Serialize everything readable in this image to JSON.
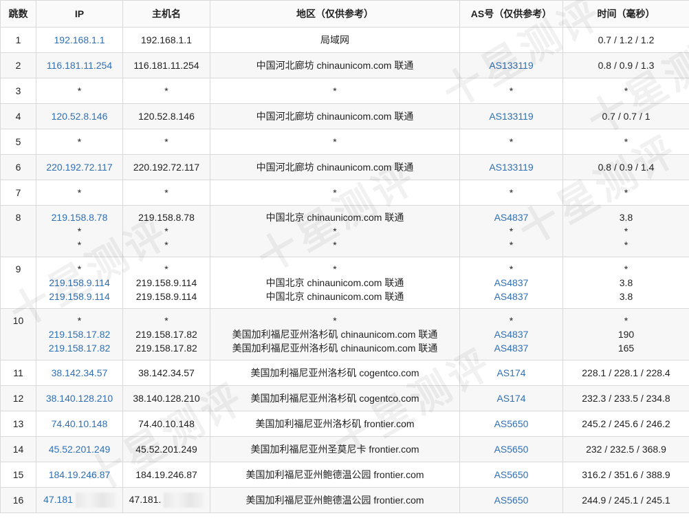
{
  "headers": [
    "跳数",
    "IP",
    "主机名",
    "地区（仅供参考）",
    "AS号（仅供参考）",
    "时间（毫秒）"
  ],
  "rows": [
    {
      "hop": "1",
      "lines": [
        {
          "ip": "192.168.1.1",
          "host": "192.168.1.1",
          "region": "局域网",
          "as": "",
          "time": "0.7 / 1.2 / 1.2"
        }
      ]
    },
    {
      "hop": "2",
      "lines": [
        {
          "ip": "116.181.11.254",
          "host": "116.181.11.254",
          "region": "中国河北廊坊 chinaunicom.com 联通",
          "as": "AS133119",
          "time": "0.8 / 0.9 / 1.3"
        }
      ]
    },
    {
      "hop": "3",
      "lines": [
        {
          "ip": "*",
          "host": "*",
          "region": "*",
          "as": "*",
          "time": "*"
        }
      ]
    },
    {
      "hop": "4",
      "lines": [
        {
          "ip": "120.52.8.146",
          "host": "120.52.8.146",
          "region": "中国河北廊坊 chinaunicom.com 联通",
          "as": "AS133119",
          "time": "0.7 / 0.7 / 1"
        }
      ]
    },
    {
      "hop": "5",
      "lines": [
        {
          "ip": "*",
          "host": "*",
          "region": "*",
          "as": "*",
          "time": "*"
        }
      ]
    },
    {
      "hop": "6",
      "lines": [
        {
          "ip": "220.192.72.117",
          "host": "220.192.72.117",
          "region": "中国河北廊坊 chinaunicom.com 联通",
          "as": "AS133119",
          "time": "0.8 / 0.9 / 1.4"
        }
      ]
    },
    {
      "hop": "7",
      "lines": [
        {
          "ip": "*",
          "host": "*",
          "region": "*",
          "as": "*",
          "time": "*"
        }
      ]
    },
    {
      "hop": "8",
      "lines": [
        {
          "ip": "219.158.8.78",
          "host": "219.158.8.78",
          "region": "中国北京 chinaunicom.com 联通",
          "as": "AS4837",
          "time": "3.8"
        },
        {
          "ip": "*",
          "host": "*",
          "region": "*",
          "as": "*",
          "time": "*"
        },
        {
          "ip": "*",
          "host": "*",
          "region": "*",
          "as": "*",
          "time": "*"
        }
      ]
    },
    {
      "hop": "9",
      "lines": [
        {
          "ip": "*",
          "host": "*",
          "region": "*",
          "as": "*",
          "time": "*"
        },
        {
          "ip": "219.158.9.114",
          "host": "219.158.9.114",
          "region": "中国北京 chinaunicom.com 联通",
          "as": "AS4837",
          "time": "3.8"
        },
        {
          "ip": "219.158.9.114",
          "host": "219.158.9.114",
          "region": "中国北京 chinaunicom.com 联通",
          "as": "AS4837",
          "time": "3.8"
        }
      ]
    },
    {
      "hop": "10",
      "lines": [
        {
          "ip": "*",
          "host": "*",
          "region": "*",
          "as": "*",
          "time": "*"
        },
        {
          "ip": "219.158.17.82",
          "host": "219.158.17.82",
          "region": "美国加利福尼亚州洛杉矶 chinaunicom.com 联通",
          "as": "AS4837",
          "time": "190"
        },
        {
          "ip": "219.158.17.82",
          "host": "219.158.17.82",
          "region": "美国加利福尼亚州洛杉矶 chinaunicom.com 联通",
          "as": "AS4837",
          "time": "165"
        }
      ]
    },
    {
      "hop": "11",
      "lines": [
        {
          "ip": "38.142.34.57",
          "host": "38.142.34.57",
          "region": "美国加利福尼亚州洛杉矶 cogentco.com",
          "as": "AS174",
          "time": "228.1 / 228.1 / 228.4"
        }
      ]
    },
    {
      "hop": "12",
      "lines": [
        {
          "ip": "38.140.128.210",
          "host": "38.140.128.210",
          "region": "美国加利福尼亚州洛杉矶 cogentco.com",
          "as": "AS174",
          "time": "232.3 / 233.5 / 234.8"
        }
      ]
    },
    {
      "hop": "13",
      "lines": [
        {
          "ip": "74.40.10.148",
          "host": "74.40.10.148",
          "region": "美国加利福尼亚州洛杉矶 frontier.com",
          "as": "AS5650",
          "time": "245.2 / 245.6 / 246.2"
        }
      ]
    },
    {
      "hop": "14",
      "lines": [
        {
          "ip": "45.52.201.249",
          "host": "45.52.201.249",
          "region": "美国加利福尼亚州圣莫尼卡 frontier.com",
          "as": "AS5650",
          "time": "232 / 232.5 / 368.9"
        }
      ]
    },
    {
      "hop": "15",
      "lines": [
        {
          "ip": "184.19.246.87",
          "host": "184.19.246.87",
          "region": "美国加利福尼亚州鲍德温公园 frontier.com",
          "as": "AS5650",
          "time": "316.2 / 351.6 / 388.9"
        }
      ]
    },
    {
      "hop": "16",
      "lines": [
        {
          "ip": "47.181",
          "host": "47.181.",
          "region": "美国加利福尼亚州鲍德温公园 frontier.com",
          "as": "AS5650",
          "time": "244.9 / 245.1 / 245.1",
          "blurred": true
        }
      ]
    }
  ],
  "watermark": "十星测评",
  "colors": {
    "link": "#2f6fb5",
    "stripe": "#f7f7f7",
    "border": "#d9d9d9"
  }
}
